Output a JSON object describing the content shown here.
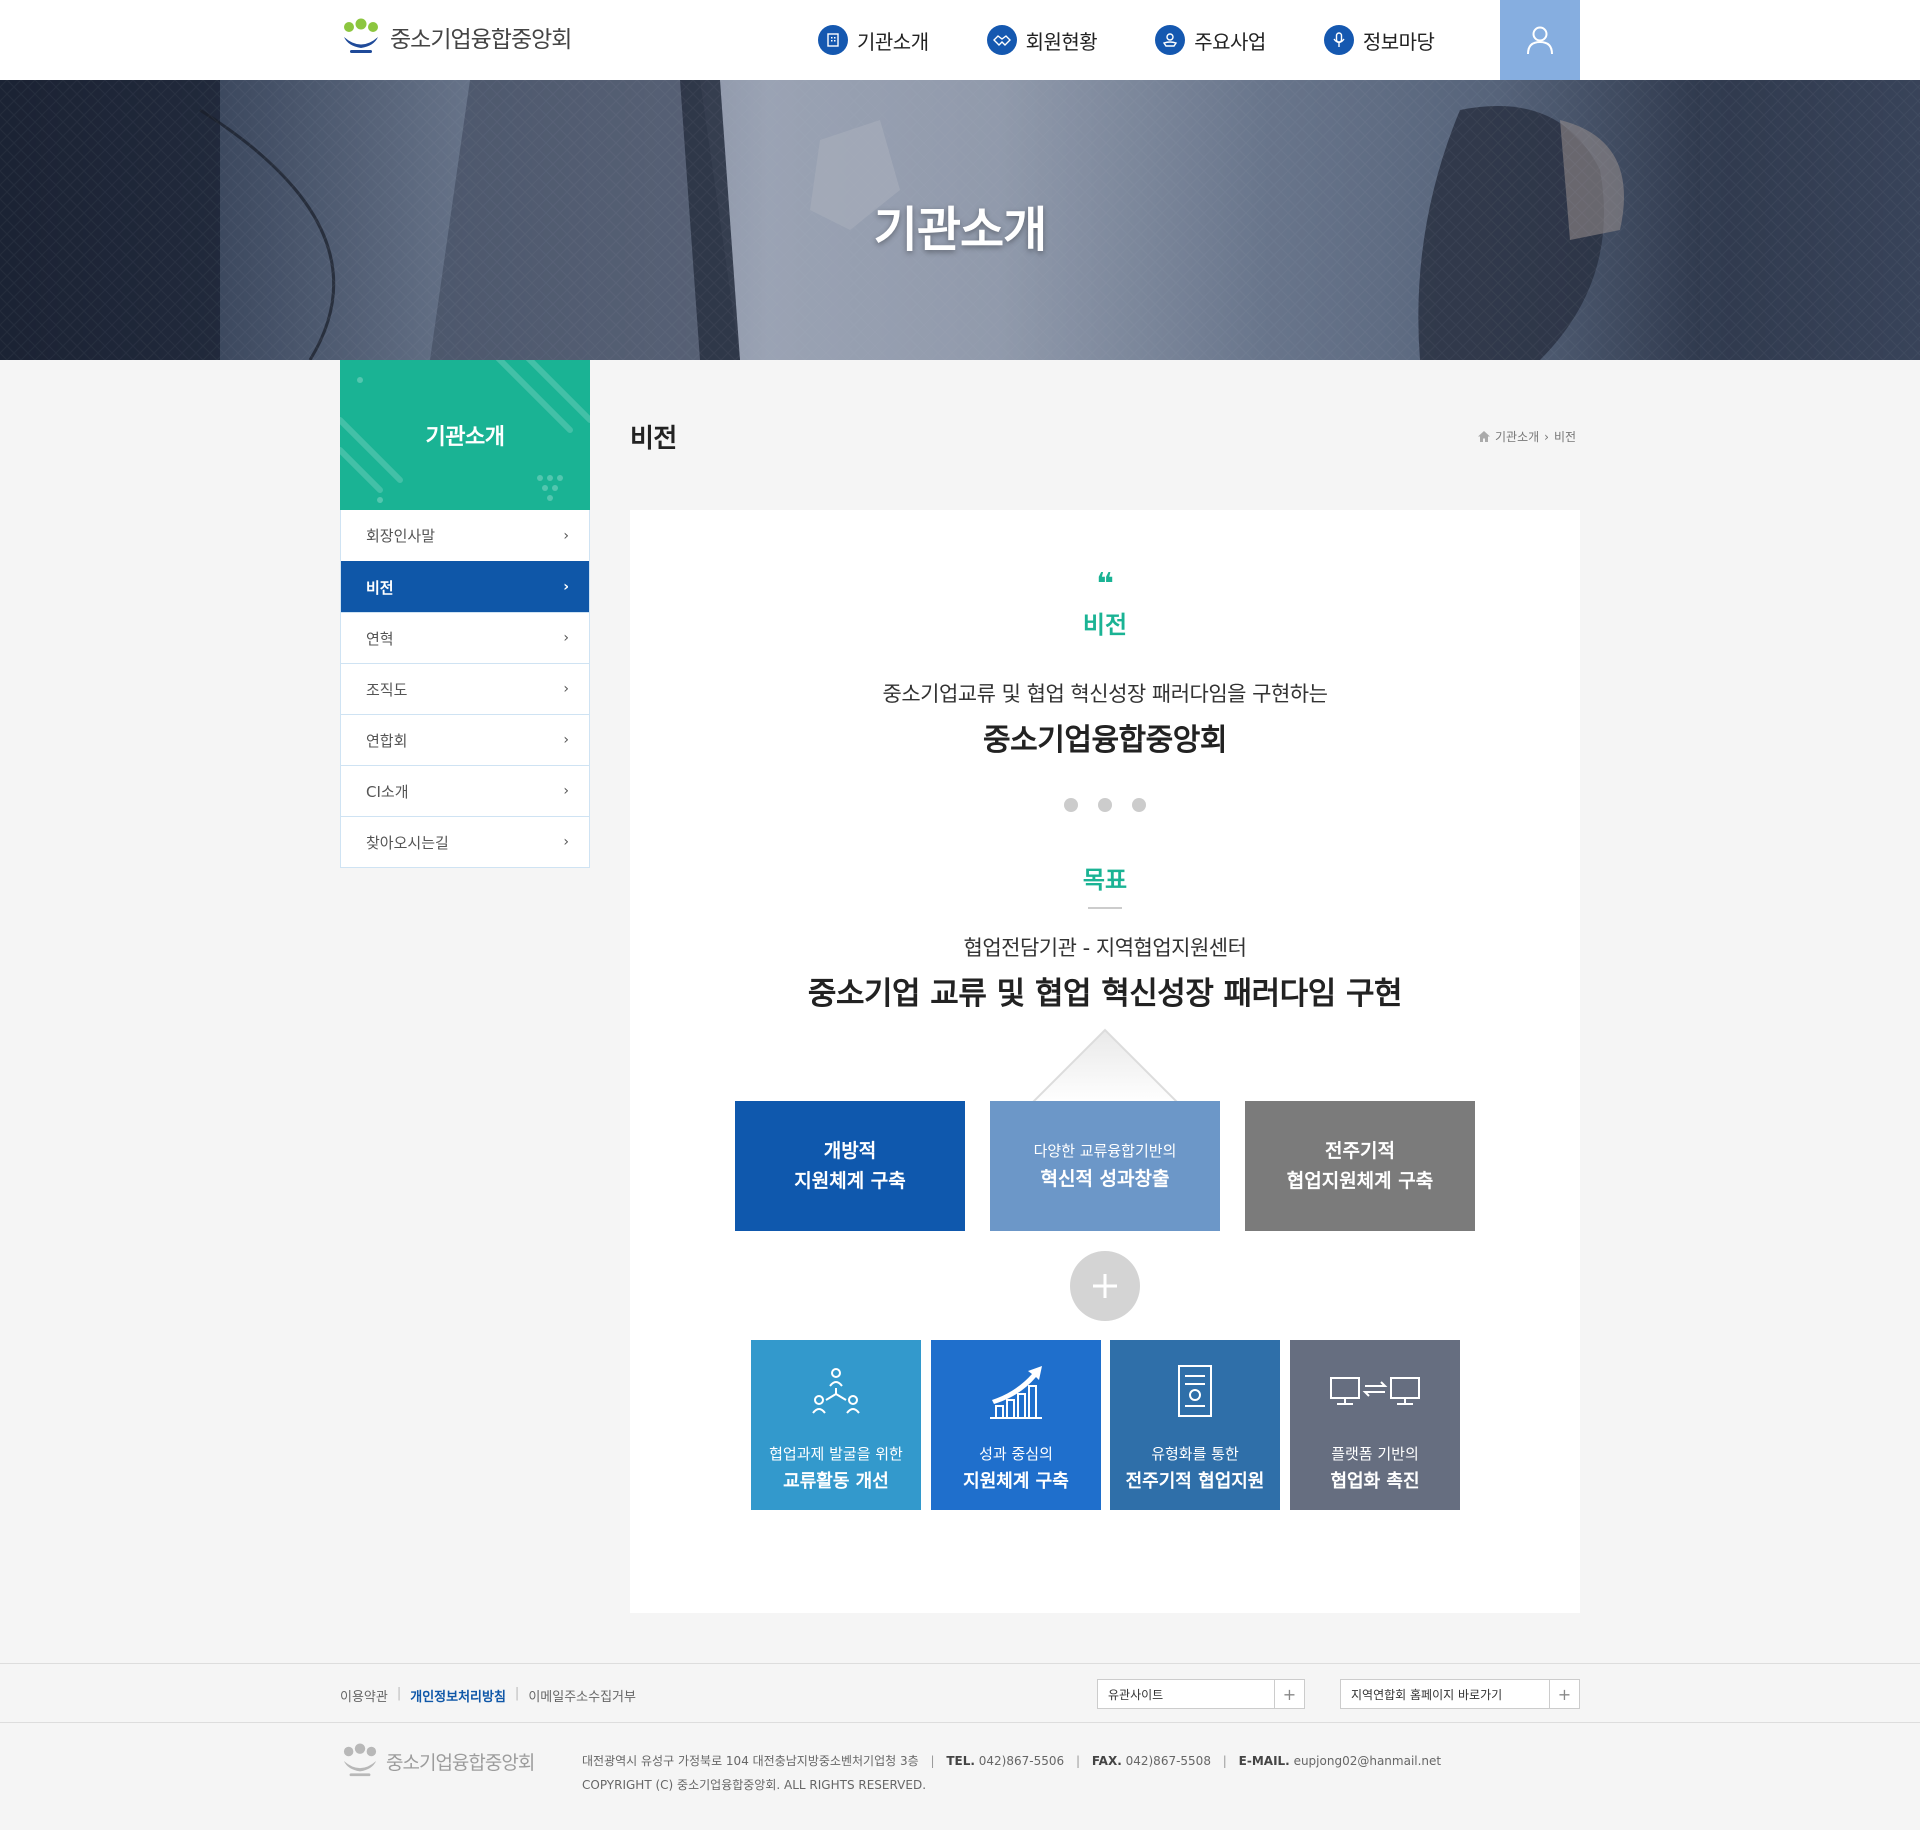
{
  "header": {
    "logo_text": "중소기업융합중앙회",
    "nav": [
      {
        "label": "기관소개",
        "icon": "building-icon"
      },
      {
        "label": "회원현황",
        "icon": "handshake-icon"
      },
      {
        "label": "주요사업",
        "icon": "hand-coin-icon"
      },
      {
        "label": "정보마당",
        "icon": "microphone-icon"
      }
    ],
    "user_icon": "user-icon"
  },
  "hero": {
    "title": "기관소개"
  },
  "lnb": {
    "title": "기관소개",
    "items": [
      {
        "label": "회장인사말",
        "active": false
      },
      {
        "label": "비전",
        "active": true
      },
      {
        "label": "연혁",
        "active": false
      },
      {
        "label": "조직도",
        "active": false
      },
      {
        "label": "연합회",
        "active": false
      },
      {
        "label": "CI소개",
        "active": false
      },
      {
        "label": "찾아오시는길",
        "active": false
      }
    ]
  },
  "content": {
    "page_title": "비전",
    "breadcrumb": [
      "기관소개",
      "비전"
    ],
    "quote_mark": "❝",
    "vision_label": "비전",
    "vision_sub": "중소기업교류 및 협업 혁신성장 패러다임을 구현하는",
    "vision_main": "중소기업융합중앙회",
    "goal_label": "목표",
    "goal_sub": "협업전담기관 - 지역협업지원센터",
    "goal_main": "중소기업 교류 및 협업 혁신성장 패러다임 구현",
    "pillars": [
      {
        "line1": "개방적",
        "line2": "지원체계 구축",
        "color": "#0f58ad"
      },
      {
        "line1": "다양한 교류융합기반의",
        "line2": "혁신적 성과창출",
        "color": "#6c97c8"
      },
      {
        "line1": "전주기적",
        "line2": "협업지원체계 구축",
        "color": "#7b7b7b"
      }
    ],
    "cards": [
      {
        "line1": "협업과제 발굴을 위한",
        "line2": "교류활동 개선",
        "icon": "people-network-icon",
        "color": "#3399cc"
      },
      {
        "line1": "성과 중심의",
        "line2": "지원체계 구축",
        "icon": "growth-chart-icon",
        "color": "#1f6fcc"
      },
      {
        "line1": "유형화를 통한",
        "line2": "전주기적 협업지원",
        "icon": "document-icon",
        "color": "#2f6fa9"
      },
      {
        "line1": "플랫폼 기반의",
        "line2": "협업화 촉진",
        "icon": "monitor-exchange-icon",
        "color": "#666e80"
      }
    ]
  },
  "footer": {
    "links": [
      "이용약관",
      "개인정보처리방침",
      "이메일주소수집거부"
    ],
    "select1": "유관사이트",
    "select2": "지역연합회 홈페이지 바로가기",
    "logo_text": "중소기업융합중앙회",
    "address": "대전광역시 유성구 가정북로 104 대전충남지방중소벤처기업청 3층",
    "tel_label": "TEL.",
    "tel": "042)867-5506",
    "fax_label": "FAX.",
    "fax": "042)867-5508",
    "email_label": "E-MAIL.",
    "email": "eupjong02@hanmail.net",
    "copyright": "COPYRIGHT (C) 중소기업융합중앙회. ALL RIGHTS RESERVED."
  }
}
